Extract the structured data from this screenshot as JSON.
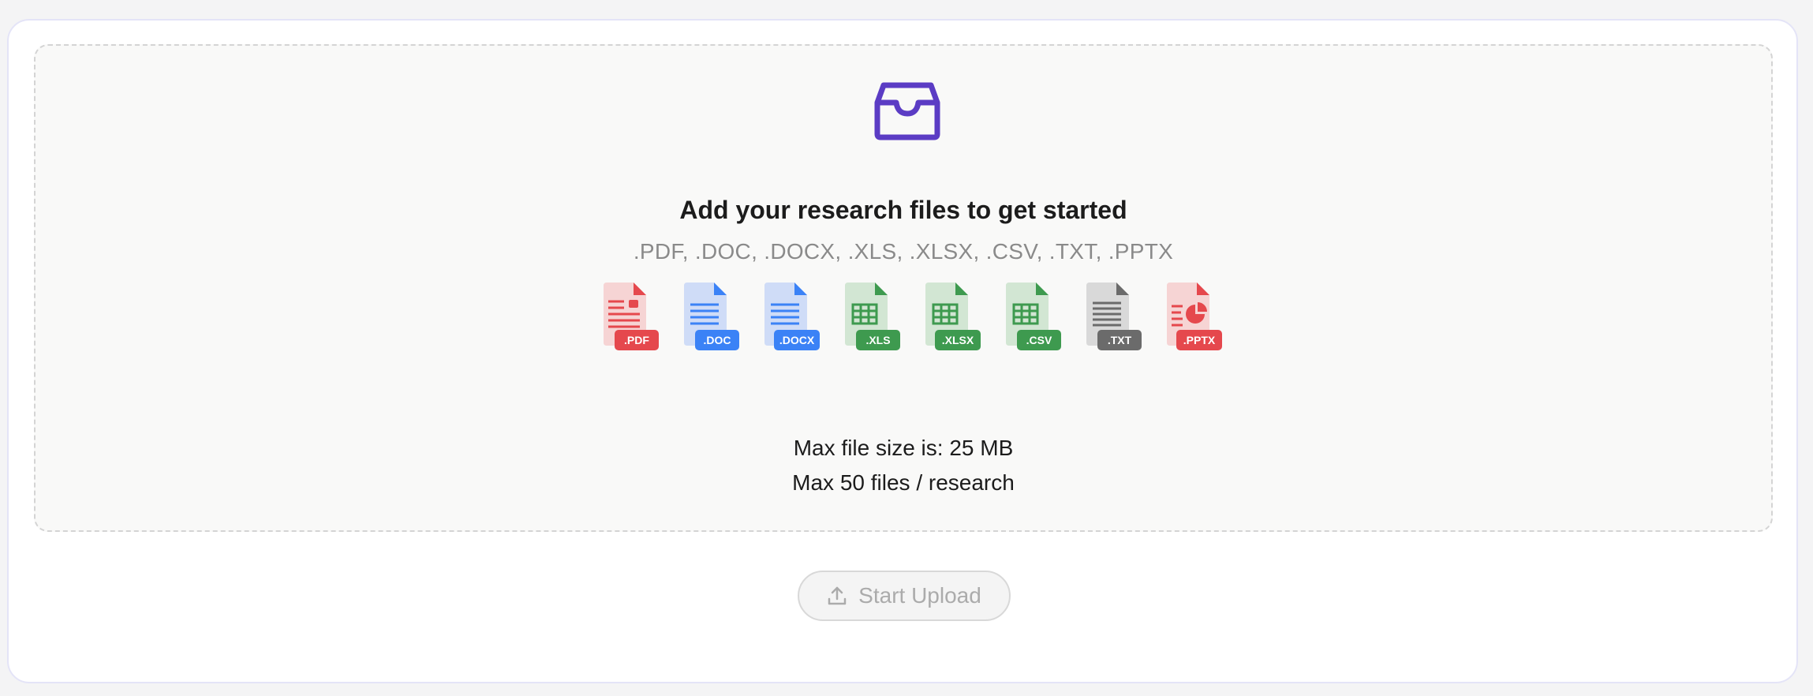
{
  "dropzone": {
    "title": "Add your research files to get started",
    "formats": ".PDF, .DOC, .DOCX, .XLS, .XLSX, .CSV, .TXT, .PPTX",
    "limits": {
      "file_size": "Max file size is: 25 MB",
      "file_count": "Max 50 files / research"
    },
    "file_types": [
      {
        "label": ".PDF",
        "icon": "pdf-file-icon",
        "color": "#e5484d",
        "fill": "#f6d4d4"
      },
      {
        "label": ".DOC",
        "icon": "doc-file-icon",
        "color": "#3b82f6",
        "fill": "#cfdcf7"
      },
      {
        "label": ".DOCX",
        "icon": "docx-file-icon",
        "color": "#3b82f6",
        "fill": "#cfdcf7"
      },
      {
        "label": ".XLS",
        "icon": "xls-file-icon",
        "color": "#3e9a4f",
        "fill": "#d2e6d3"
      },
      {
        "label": ".XLSX",
        "icon": "xlsx-file-icon",
        "color": "#3e9a4f",
        "fill": "#d2e6d3"
      },
      {
        "label": ".CSV",
        "icon": "csv-file-icon",
        "color": "#3e9a4f",
        "fill": "#d2e6d3"
      },
      {
        "label": ".TXT",
        "icon": "txt-file-icon",
        "color": "#6b6b6b",
        "fill": "#d9d9d9"
      },
      {
        "label": ".PPTX",
        "icon": "pptx-file-icon",
        "color": "#e5484d",
        "fill": "#f6d4d4"
      }
    ]
  },
  "actions": {
    "upload_label": "Start Upload",
    "upload_icon": "upload-icon"
  },
  "colors": {
    "accent": "#5b3cc4",
    "disabled_text": "#ababab"
  }
}
